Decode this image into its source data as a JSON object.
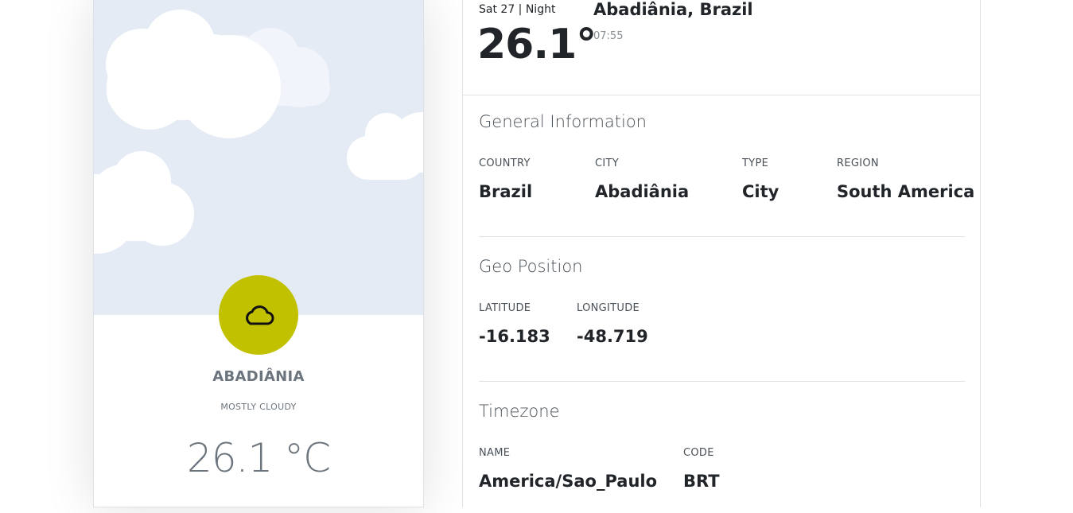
{
  "card": {
    "city": "ABADIÂNIA",
    "condition": "MOSTLY CLOUDY",
    "temperature": "26.1 °C",
    "weather_icon": "cloud-icon",
    "colors": {
      "sky": "#e5ebf5",
      "badge": "#c1c100",
      "muted_text": "#6c757d"
    }
  },
  "header": {
    "day": "Sat 27 | Night",
    "temperature": "26.1°",
    "location": "Abadiânia, Brazil",
    "time": "07:55"
  },
  "general": {
    "title": "General Information",
    "fields": [
      {
        "label": "COUNTRY",
        "value": "Brazil"
      },
      {
        "label": "CITY",
        "value": "Abadiânia"
      },
      {
        "label": "TYPE",
        "value": "City"
      },
      {
        "label": "REGION",
        "value": "South America"
      }
    ]
  },
  "geo": {
    "title": "Geo Position",
    "fields": [
      {
        "label": "LATITUDE",
        "value": "-16.183"
      },
      {
        "label": "LONGITUDE",
        "value": "-48.719"
      }
    ]
  },
  "timezone": {
    "title": "Timezone",
    "fields": [
      {
        "label": "NAME",
        "value": "America/Sao_Paulo"
      },
      {
        "label": "CODE",
        "value": "BRT"
      }
    ]
  }
}
